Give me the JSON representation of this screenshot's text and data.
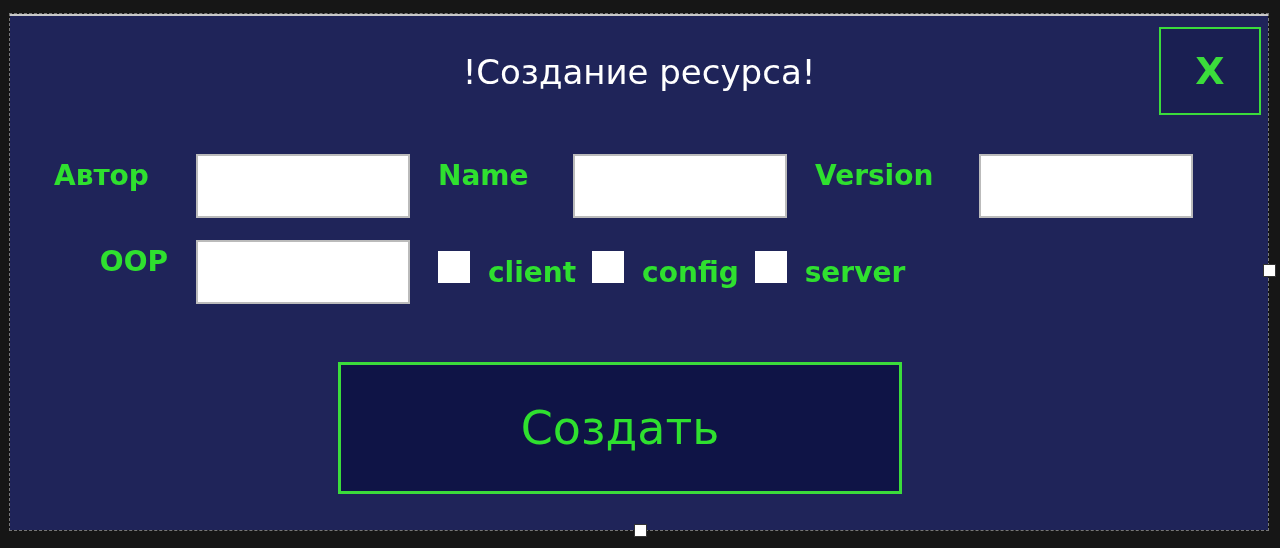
{
  "window": {
    "title": "!Создание ресурса!",
    "close_label": "X"
  },
  "fields": [
    {
      "label": "Автор"
    },
    {
      "label": "Name"
    },
    {
      "label": "Version"
    }
  ],
  "oop": {
    "label": "OOP"
  },
  "options": [
    {
      "label": "client",
      "checked": false
    },
    {
      "label": "config",
      "checked": false
    },
    {
      "label": "server",
      "checked": false
    }
  ],
  "create_button": "Создать"
}
